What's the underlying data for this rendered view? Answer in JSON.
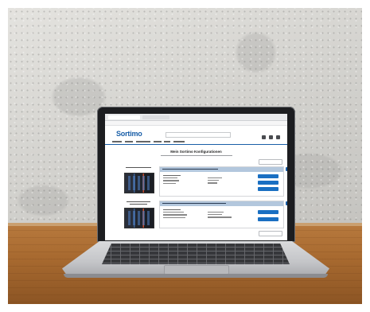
{
  "scene": {
    "description": "Laptop on a wooden table against a concrete wall, screen showing a Sortimo web page",
    "wall_color": "#d4d3cf",
    "table_color": "#a7692f",
    "laptop_color": "#c4c5c8"
  },
  "screen_page": {
    "brand": "Sortimo",
    "accent_color": "#1a5fa8",
    "title": "Mein Sortimo Konfigurationen"
  }
}
